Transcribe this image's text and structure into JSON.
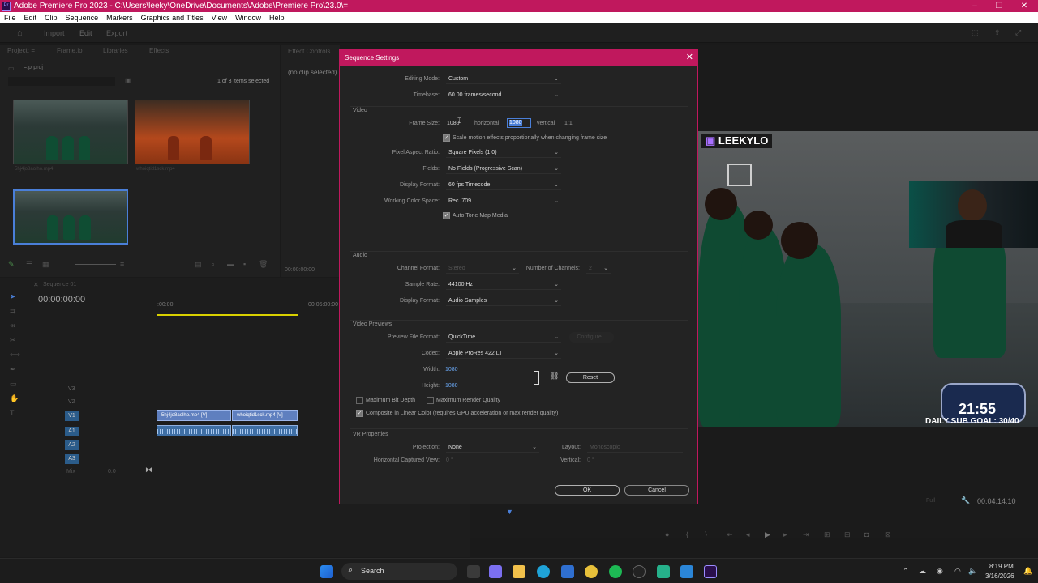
{
  "window": {
    "title": "Adobe Premiere Pro 2023 - C:\\Users\\leeky\\OneDrive\\Documents\\Adobe\\Premiere Pro\\23.0\\=",
    "logo": "Pr"
  },
  "menu": [
    "File",
    "Edit",
    "Clip",
    "Sequence",
    "Markers",
    "Graphics and Titles",
    "View",
    "Window",
    "Help"
  ],
  "workspace_tabs": [
    "Import",
    "Edit",
    "Export"
  ],
  "project": {
    "tabs": [
      "Project: =",
      "Frame.io",
      "Libraries",
      "Effects"
    ],
    "file": "=.prproj",
    "status": "1 of 3 items selected",
    "items": [
      "5hj4jo8aolho.mp4",
      "whoiqtid1sck.mp4",
      "Sequence 01"
    ]
  },
  "effect_controls": {
    "tab": "Effect Controls",
    "empty": "(no clip selected)",
    "timecode": "00:00:00:00"
  },
  "timeline": {
    "tab": "Sequence 01",
    "timecode": "00:00:00:00",
    "ruler_start": ":00:00",
    "ruler_mid": "00:05:00:00",
    "tracks": [
      "V3",
      "V2",
      "V1",
      "A1",
      "A2",
      "A3",
      "Mix"
    ],
    "mix_value": "0.0",
    "clips": [
      "5hj4jo8aolho.mp4 [V]",
      "whoiqtid1sck.mp4 [V]"
    ]
  },
  "program": {
    "fit": "Full",
    "timecode": "00:04:14:10",
    "overlay_channel": "LEEKYLO",
    "overlay_timer": "21:55",
    "overlay_sub": "DAILY SUB GOAL: 30/40"
  },
  "dialog": {
    "title": "Sequence Settings",
    "close": "✕",
    "editing_mode_label": "Editing Mode:",
    "editing_mode": "Custom",
    "timebase_label": "Timebase:",
    "timebase": "60.00  frames/second",
    "video_section": "Video",
    "frame_size_label": "Frame Size:",
    "frame_w": "1080",
    "horizontal": "horizontal",
    "frame_h": "1080",
    "vertical": "vertical",
    "ratio": "1:1",
    "scale_motion": "Scale motion effects proportionally when changing frame size",
    "par_label": "Pixel Aspect Ratio:",
    "par": "Square Pixels (1.0)",
    "fields_label": "Fields:",
    "fields": "No Fields (Progressive Scan)",
    "display_format_label": "Display Format:",
    "display_format": "60 fps Timecode",
    "color_space_label": "Working Color Space:",
    "color_space": "Rec. 709",
    "tone_map": "Auto Tone Map Media",
    "audio_section": "Audio",
    "channel_format_label": "Channel Format:",
    "channel_format": "Stereo",
    "num_channels_label": "Number of Channels:",
    "num_channels": "2",
    "sample_rate_label": "Sample Rate:",
    "sample_rate": "44100 Hz",
    "audio_display_label": "Display Format:",
    "audio_display": "Audio Samples",
    "previews_section": "Video Previews",
    "preview_format_label": "Preview File Format:",
    "preview_format": "QuickTime",
    "configure": "Configure...",
    "codec_label": "Codec:",
    "codec": "Apple ProRes 422 LT",
    "width_label": "Width:",
    "width": "1080",
    "height_label": "Height:",
    "height": "1080",
    "reset": "Reset",
    "max_bit_depth": "Maximum Bit Depth",
    "max_render": "Maximum Render Quality",
    "composite_linear": "Composite in Linear Color (requires GPU acceleration or max render quality)",
    "vr_section": "VR Properties",
    "projection_label": "Projection:",
    "projection": "None",
    "layout_label": "Layout:",
    "layout": "Monoscopic",
    "h_captured_label": "Horizontal Captured View:",
    "h_captured": "0 °",
    "vertical_label": "Vertical:",
    "vertical_val": "0 °",
    "ok": "OK",
    "cancel": "Cancel"
  },
  "taskbar": {
    "search": "Search",
    "time": "8:19 PM",
    "date": "3/16/2026"
  },
  "colors": {
    "accent": "#c0185d",
    "selection": "#4a7fd8",
    "link": "#6aa8f5"
  }
}
